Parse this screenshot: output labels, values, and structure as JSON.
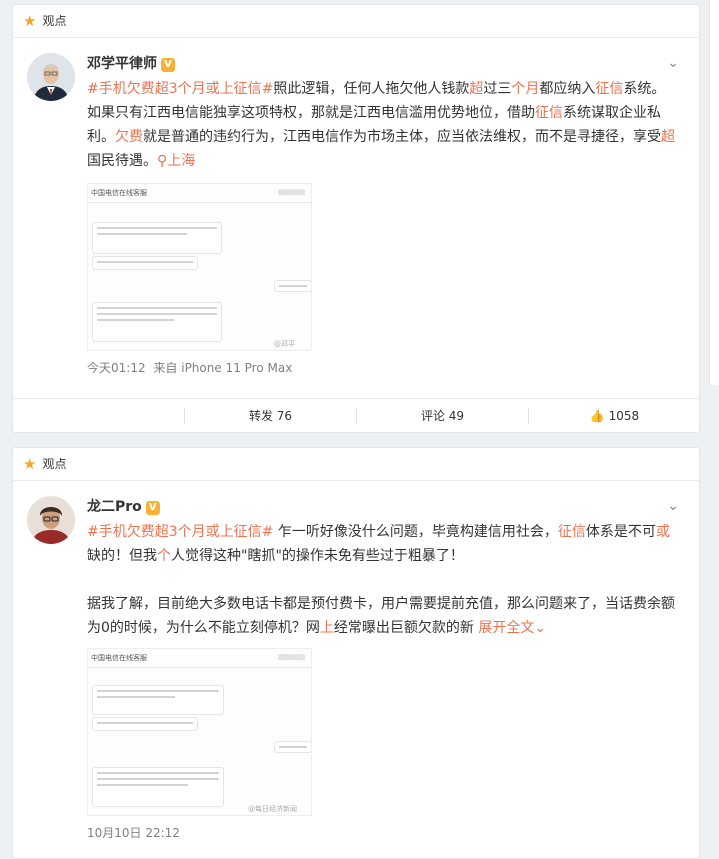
{
  "posts": [
    {
      "section_label": "观点",
      "author": "邓学平律师",
      "badge": "V",
      "text": {
        "topic": "#手机欠费超3个月或上征信#",
        "p1": "照此逻辑，任何人拖欠他人钱款",
        "kw1": "超",
        "p2": "过三",
        "kw2": "个月",
        "p3": "都应纳入",
        "kw3": "征信",
        "p4": "系统。如果只有江西电信能独享这项特权，那就是江西电信滥用优势地位，借助",
        "kw4": "征信",
        "p5": "系统谋取企业私利。",
        "kw5": "欠费",
        "p6": "就是普通的违约行为，江西电信作为市场主体，应当依法维权，而不是寻捷径，享受",
        "kw6": "超",
        "p7": "国民待遇。",
        "location": "上海"
      },
      "image_header": "中国电信在线客服",
      "image_watermark": "@邓平",
      "time": "今天01:12",
      "source": "来自 iPhone 11 Pro Max",
      "repost_label": "转发",
      "repost_count": "76",
      "comment_label": "评论",
      "comment_count": "49",
      "like_count": "1058"
    },
    {
      "section_label": "观点",
      "author": "龙二Pro",
      "badge": "V",
      "text": {
        "topic": "#手机欠费超3个月或上征信#",
        "p1": " 乍一听好像没什么问题，毕竟构建信用社会，",
        "kw1": "征信",
        "p2": "体系是不可",
        "kw2": "或",
        "p3": "缺的！但我",
        "kw3": "个",
        "p4": "人觉得这种\"瞎抓\"的操作未免有些过于粗暴了！",
        "para2": "据我了解，目前绝大多数电话卡都是预付费卡，用户需要提前充值，那么问题来了，当话费余额为0的时候，为什么不能立刻停机？网",
        "kw4": "上",
        "para2b": "经常曝出巨额欠款的新",
        "expand": "展开全文"
      },
      "image_header": "中国电信在线客服",
      "image_watermark": "@每日经济新闻",
      "time": "10月10日 22:12"
    }
  ]
}
